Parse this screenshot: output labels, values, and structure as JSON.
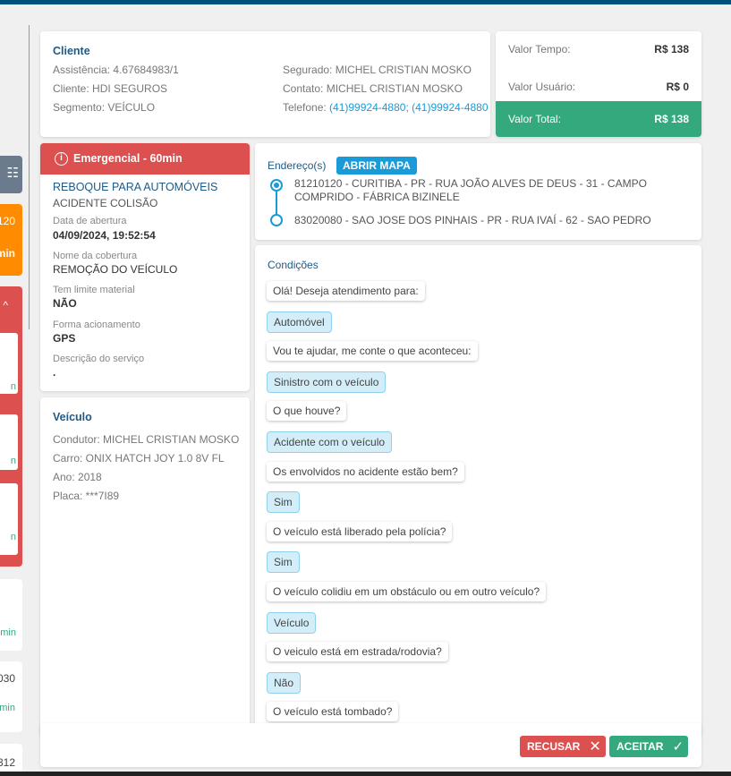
{
  "cliente": {
    "title": "Cliente",
    "assistencia": "Assistência: 4.67684983/1",
    "cliente": "Cliente: HDI SEGUROS",
    "segmento": "Segmento: VEÍCULO",
    "segurado": "Segurado: MICHEL CRISTIAN MOSKO",
    "contato": "Contato: MICHEL CRISTIAN MOSKO",
    "telefone_label": "Telefone: ",
    "telefone": "(41)99924-4880; (41)99924-4880"
  },
  "valores": {
    "tempo_label": "Valor Tempo:",
    "tempo": "R$ 138",
    "usuario_label": "Valor Usuário:",
    "usuario": "R$ 0",
    "total_label": "Valor Total:",
    "total": "R$ 138"
  },
  "servico": {
    "badge": "Emergencial - 60min",
    "tipo": "REBOQUE PARA AUTOMÓVEIS",
    "motivo": "ACIDENTE COLISÃO",
    "data_label": "Data de abertura",
    "data": "04/09/2024, 19:52:54",
    "cobertura_label": "Nome da cobertura",
    "cobertura": "REMOÇÃO DO VEÍCULO",
    "limite_label": "Tem limite material",
    "limite": "NÃO",
    "forma_label": "Forma acionamento",
    "forma": "GPS",
    "descricao_label": "Descrição do serviço",
    "descricao": "."
  },
  "veiculo": {
    "title": "Veículo",
    "condutor": "Condutor: MICHEL CRISTIAN MOSKO",
    "carro": "Carro: ONIX HATCH JOY 1.0 8V FL",
    "ano": "Ano: 2018",
    "placa": "Placa: ***7I89"
  },
  "enderecos": {
    "title": "Endereço(s)",
    "map_button": "ABRIR MAPA",
    "origem": "81210120 - CURITIBA - PR - RUA JOÃO ALVES DE DEUS - 31 - CAMPO COMPRIDO - FÁBRICA BIZINELE",
    "destino": "83020080 - SAO JOSE DOS PINHAIS - PR - RUA IVAÍ - 62 - SAO PEDRO"
  },
  "condicoes": {
    "title": "Condições",
    "messages": [
      {
        "text": "Olá! Deseja atendimento para:",
        "answer": false
      },
      {
        "text": "Automóvel",
        "answer": true
      },
      {
        "text": "Vou te ajudar, me conte o que aconteceu:",
        "answer": false
      },
      {
        "text": "Sinistro com o veículo",
        "answer": true
      },
      {
        "text": "O que houve?",
        "answer": false
      },
      {
        "text": "Acidente com o veículo",
        "answer": true
      },
      {
        "text": "Os envolvidos no acidente estão bem?",
        "answer": false
      },
      {
        "text": "Sim",
        "answer": true
      },
      {
        "text": "O veículo está liberado pela polícia?",
        "answer": false
      },
      {
        "text": "Sim",
        "answer": true
      },
      {
        "text": "O veículo colidiu em um obstáculo ou em outro veículo?",
        "answer": false
      },
      {
        "text": "Veículo",
        "answer": true
      },
      {
        "text": "O veiculo está em estrada/rodovia?",
        "answer": false
      },
      {
        "text": "Não",
        "answer": true
      },
      {
        "text": "O veículo está tombado?",
        "answer": false
      }
    ]
  },
  "sidebar": {
    "orange_top": "120",
    "orange_bottom": "min",
    "cards": [
      "n",
      "n",
      "n",
      "min",
      "030",
      "min",
      "312"
    ]
  },
  "actions": {
    "recusar": "RECUSAR",
    "aceitar": "ACEITAR"
  },
  "colors": {
    "primary": "#1d5a86",
    "accent": "#1a9bd7",
    "danger": "#dc5050",
    "success": "#35a97e",
    "warning": "#ff8c00"
  }
}
